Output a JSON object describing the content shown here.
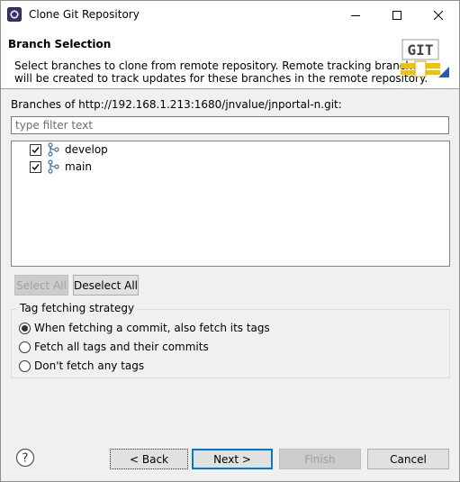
{
  "window": {
    "title": "Clone Git Repository",
    "title_icon": "eclipse-icon",
    "controls": {
      "minimize": "minimize-icon",
      "maximize": "maximize-icon",
      "close": "close-icon"
    }
  },
  "header": {
    "title": "Branch Selection",
    "description_line1": "Select branches to clone from remote repository. Remote tracking branches",
    "description_line2": "will be created to track updates for these branches in the remote repository.",
    "logo_text": "GIT",
    "logo_icon": "git-logo-icon"
  },
  "branches": {
    "label": "Branches of http://192.168.1.213:1680/jnvalue/jnportal-n.git:",
    "filter_placeholder": "type filter text",
    "filter_value": "",
    "items": [
      {
        "label": "develop",
        "checked": true,
        "icon": "branch-icon"
      },
      {
        "label": "main",
        "checked": true,
        "icon": "branch-icon"
      }
    ],
    "select_all": "Select All",
    "deselect_all": "Deselect All"
  },
  "tag_strategy": {
    "title": "Tag fetching strategy",
    "options": [
      {
        "label": "When fetching a commit, also fetch its tags",
        "selected": true
      },
      {
        "label": "Fetch all tags and their commits",
        "selected": false
      },
      {
        "label": "Don't fetch any tags",
        "selected": false
      }
    ]
  },
  "footer": {
    "help_icon": "help-icon",
    "back": "< Back",
    "next": "Next >",
    "finish": "Finish",
    "cancel": "Cancel"
  },
  "colors": {
    "accent": "#0078d7",
    "background": "#f0f0f0",
    "disabled_text": "#a0a0a0"
  }
}
